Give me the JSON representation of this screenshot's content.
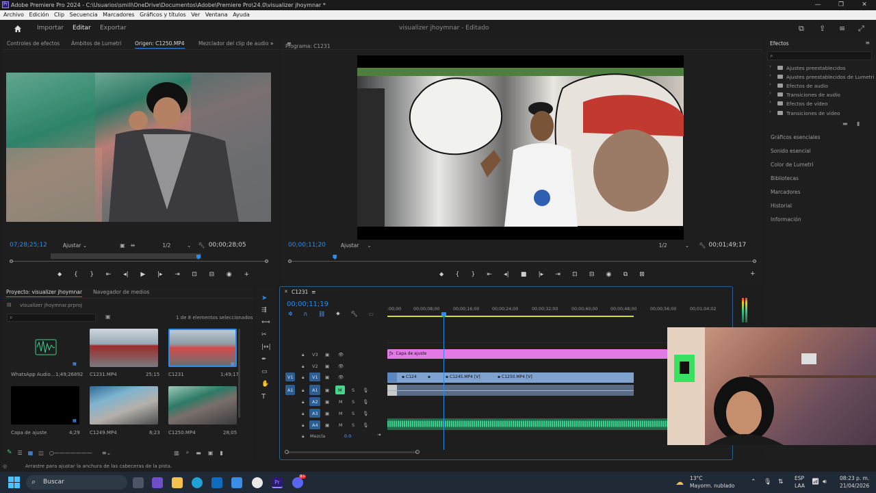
{
  "window": {
    "title": "Adobe Premiere Pro 2024 - C:\\Usuarios\\smili\\OneDrive\\Documentos\\Adobe\\Premiere Pro\\24.0\\visualizer jhoymnar *"
  },
  "menu": [
    "Archivo",
    "Edición",
    "Clip",
    "Secuencia",
    "Marcadores",
    "Gráficos y títulos",
    "Ver",
    "Ventana",
    "Ayuda"
  ],
  "header": {
    "nav": [
      "Importar",
      "Editar",
      "Exportar"
    ],
    "active": "Editar",
    "document": "visualizer jhoymnar",
    "status": "- Editado"
  },
  "source_panel": {
    "tabs": [
      "Controles de efectos",
      "Ámbitos de Lumetri",
      "Origen: C1250.MP4",
      "Mezclador del clip de audio"
    ],
    "active_tab": "Origen: C1250.MP4",
    "timecode_in": "07;28;25;12",
    "zoom": "Ajustar",
    "resolution": "1/2",
    "duration": "00;00;28;05",
    "playhead_fraction": 0.73
  },
  "program_panel": {
    "title": "Programa: C1231",
    "timecode": "00;00;11;20",
    "zoom": "Ajustar",
    "resolution": "1/2",
    "duration": "00;01;49;17",
    "playhead_fraction": 0.1
  },
  "effects_panel": {
    "title": "Efectos",
    "tree": [
      "Ajustes preestablecidos",
      "Ajustes preestablecidos de Lumetri",
      "Efectos de audio",
      "Transiciones de audio",
      "Efectos de vídeo",
      "Transiciones de vídeo"
    ],
    "sections": [
      "Gráficos esenciales",
      "Sonido esencial",
      "Color de Lumetri",
      "Bibliotecas",
      "Marcadores",
      "Historial",
      "Información"
    ]
  },
  "project_panel": {
    "tabs": [
      "Proyecto: visualizer jhoymnar",
      "Navegador de medios"
    ],
    "file": "visualizer jhoymnar.prproj",
    "selection": "1 de 8 elementos seleccionados",
    "items": [
      {
        "name": "WhatsApp Audio...",
        "duration": "1;49;26892"
      },
      {
        "name": "C1231.MP4",
        "duration": "25;15"
      },
      {
        "name": "C1231",
        "duration": "1;49;17"
      },
      {
        "name": "Capa de ajuste",
        "duration": "4;29"
      },
      {
        "name": "C1249.MP4",
        "duration": "8;23"
      },
      {
        "name": "C1250.MP4",
        "duration": "28;05"
      }
    ]
  },
  "timeline": {
    "sequence": "C1231",
    "timecode": "00;00;11;19",
    "ruler": [
      ":00;00",
      "00;00;08;00",
      "00;00;16;00",
      "00;00;24;00",
      "00;00;32;00",
      "00;00;40;00",
      "00;00;48;00",
      "00;00;56;00",
      "00;01;04;02"
    ],
    "tracks": {
      "video": [
        "V3",
        "V2",
        "V1"
      ],
      "audio": [
        "A1",
        "A2",
        "A3",
        "A4"
      ],
      "mix_label": "Mezcla",
      "mix_value": "0.0"
    },
    "clips": {
      "adjustment": "Capa de ajuste",
      "v1": [
        "C124",
        "C1245.MP4 [V]",
        "C1250.MP4 [V]"
      ]
    },
    "track_letters": {
      "mute": "M",
      "solo": "S"
    }
  },
  "status_bar": {
    "text": "Arrastre para ajustar la anchura de las cabeceras de la pista."
  },
  "taskbar": {
    "search": "Buscar",
    "weather_temp": "13°C",
    "weather_desc": "Mayorm. nublado",
    "lang": "ESP",
    "lang2": "LAA",
    "time": "08:23 p. m.",
    "date": "21/04/2026",
    "badge": "9+"
  },
  "colors": {
    "accent": "#2d8ceb",
    "adjustment_clip": "#e27ae6",
    "video_clip": "#7fa3cf",
    "audio_wave": "#3bd18c",
    "mute_active": "#46d68a"
  }
}
